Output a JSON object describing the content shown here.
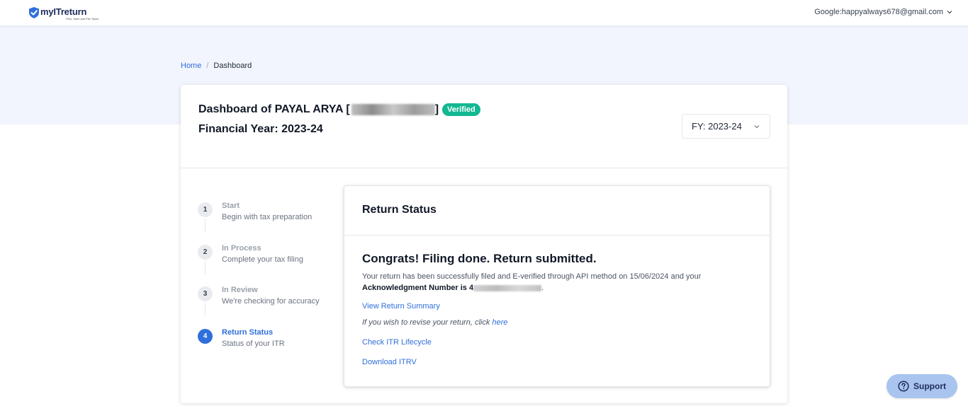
{
  "header": {
    "logo_name": "myITreturn",
    "logo_tagline": "Plan, Save and File Taxes",
    "account_label": "Google:happyalways678@gmail.com"
  },
  "breadcrumb": {
    "home": "Home",
    "separator": "/",
    "current": "Dashboard"
  },
  "dashboard": {
    "title_prefix": "Dashboard of PAYAL ARYA [",
    "title_suffix": "]",
    "verified_badge": "Verified",
    "financial_year_title": "Financial Year: 2023-24",
    "fy_select_value": "FY: 2023-24"
  },
  "steps": [
    {
      "number": "1",
      "title": "Start",
      "subtitle": "Begin with tax preparation"
    },
    {
      "number": "2",
      "title": "In Process",
      "subtitle": "Complete your tax filing"
    },
    {
      "number": "3",
      "title": "In Review",
      "subtitle": "We're checking for accuracy"
    },
    {
      "number": "4",
      "title": "Return Status",
      "subtitle": "Status of your ITR"
    }
  ],
  "status": {
    "heading": "Return Status",
    "congrats": "Congrats! Filing done. Return submitted.",
    "description": "Your return has been successfully filed and E-verified through API method on 15/06/2024 and your",
    "ack_label": "Acknowledgment Number is 4",
    "ack_end": ".",
    "view_summary": "View Return Summary",
    "revise_text": "If you wish to revise your return, click ",
    "revise_link": "here",
    "check_lifecycle": "Check ITR Lifecycle",
    "download_itrv": "Download ITRV"
  },
  "support": {
    "label": "Support"
  },
  "colors": {
    "accent": "#2f6fdb",
    "verified": "#12b892",
    "hero_bg": "#f2f5fd",
    "support_bg": "#a8c4ef"
  }
}
